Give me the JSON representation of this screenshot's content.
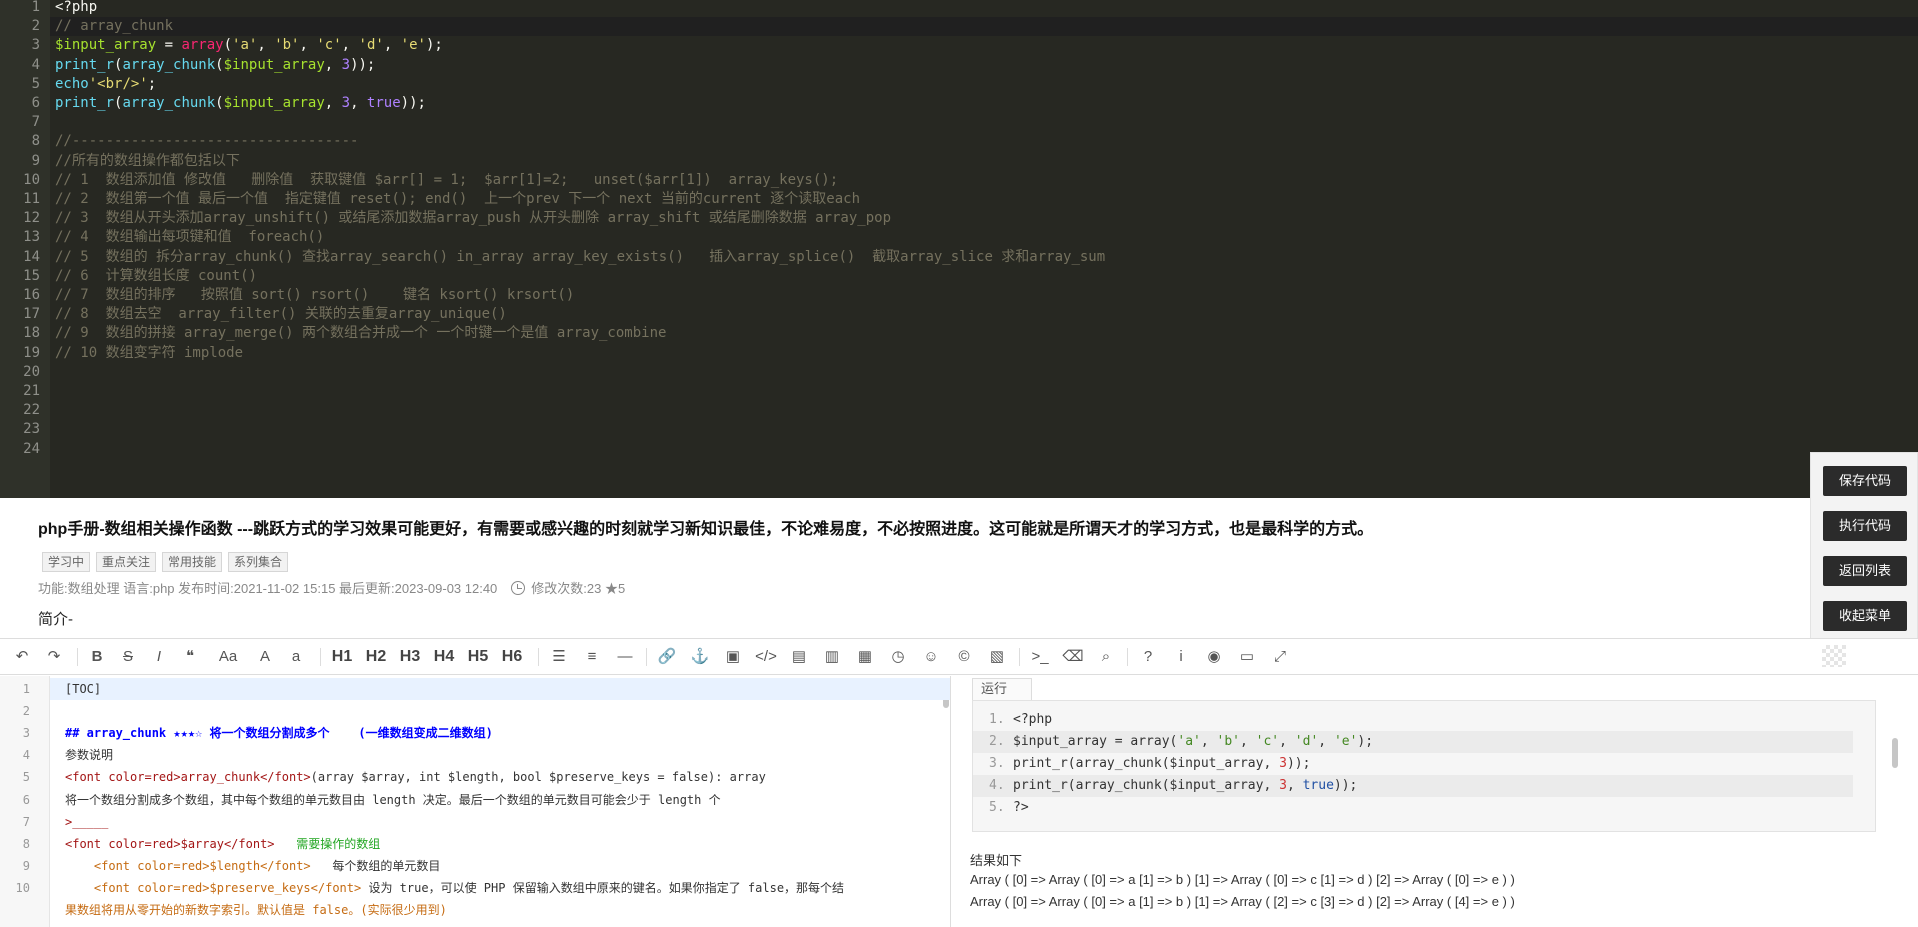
{
  "top_editor": {
    "line_numbers": [
      "1",
      "2",
      "3",
      "4",
      "5",
      "6",
      "7",
      "8",
      "9",
      "10",
      "11",
      "12",
      "13",
      "14",
      "15",
      "16",
      "17",
      "18",
      "19",
      "20",
      "21",
      "22",
      "23",
      "24"
    ],
    "lines": [
      "<?php",
      "// array_chunk",
      "$input_array = array('a', 'b', 'c', 'd', 'e');",
      "print_r(array_chunk($input_array, 3));",
      "echo'<br/>';",
      "print_r(array_chunk($input_array, 3, true));",
      "",
      "//----------------------------------",
      "//所有的数组操作都包括以下",
      "// 1  数组添加值 修改值   删除值  获取键值 $arr[] = 1;  $arr[1]=2;   unset($arr[1])  array_keys();",
      "// 2  数组第一个值 最后一个值  指定键值 reset(); end()  上一个prev 下一个 next 当前的current 逐个读取each",
      "// 3  数组从开头添加array_unshift() 或结尾添加数据array_push 从开头删除 array_shift 或结尾删除数据 array_pop",
      "// 4  数组输出每项键和值  foreach()",
      "// 5  数组的 拆分array_chunk() 查找array_search() in_array array_key_exists()   插入array_splice()  截取array_slice 求和array_sum",
      "// 6  计算数组长度 count()",
      "// 7  数组的排序   按照值 sort() rsort()    键名 ksort() krsort()",
      "// 8  数组去空  array_filter() 关联的去重复array_unique()",
      "// 9  数组的拼接 array_merge() 两个数组合并成一个 一个时键一个是值 array_combine",
      "// 10 数组变字符 implode",
      "",
      "",
      "",
      "",
      ""
    ]
  },
  "side_buttons": {
    "save": "保存代码",
    "run": "执行代码",
    "back": "返回列表",
    "collapse": "收起菜单"
  },
  "article": {
    "title": "php手册-数组相关操作函数 ---跳跃方式的学习效果可能更好，有需要或感兴趣的时刻就学习新知识最佳，不论难易度，不必按照进度。这可能就是所谓天才的学习方式，也是最科学的方式。",
    "tags": [
      "学习中",
      "重点关注",
      "常用技能",
      "系列集合"
    ],
    "meta_left": "功能:数组处理 语言:php 发布时间:2021-11-02 15:15 最后更新:2023-09-03 12:40",
    "meta_right": "修改次数:23 ★5",
    "intro": "简介-"
  },
  "toolbar": {
    "items": [
      {
        "name": "undo-icon",
        "glyph": "↶"
      },
      {
        "name": "redo-icon",
        "glyph": "↷"
      },
      {
        "name": "bold-button",
        "glyph": "B"
      },
      {
        "name": "strikethrough-button",
        "glyph": "S"
      },
      {
        "name": "italic-button",
        "glyph": "I"
      },
      {
        "name": "quote-icon",
        "glyph": "❝"
      },
      {
        "name": "uppercase-button",
        "glyph": "Aa"
      },
      {
        "name": "uppercase-a-button",
        "glyph": "A"
      },
      {
        "name": "lowercase-a-button",
        "glyph": "a"
      },
      {
        "name": "h1-button",
        "glyph": "H1"
      },
      {
        "name": "h2-button",
        "glyph": "H2"
      },
      {
        "name": "h3-button",
        "glyph": "H3"
      },
      {
        "name": "h4-button",
        "glyph": "H4"
      },
      {
        "name": "h5-button",
        "glyph": "H5"
      },
      {
        "name": "h6-button",
        "glyph": "H6"
      },
      {
        "name": "unordered-list-icon",
        "glyph": "☰"
      },
      {
        "name": "ordered-list-icon",
        "glyph": "≡"
      },
      {
        "name": "horizontal-rule-icon",
        "glyph": "—"
      },
      {
        "name": "link-icon",
        "glyph": "🔗"
      },
      {
        "name": "anchor-icon",
        "glyph": "⚓"
      },
      {
        "name": "image-icon",
        "glyph": "▣"
      },
      {
        "name": "code-icon",
        "glyph": "</>"
      },
      {
        "name": "code-file-icon",
        "glyph": "▤"
      },
      {
        "name": "code-block-icon",
        "glyph": "▥"
      },
      {
        "name": "table-icon",
        "glyph": "▦"
      },
      {
        "name": "datetime-icon",
        "glyph": "◷"
      },
      {
        "name": "emoji-icon",
        "glyph": "☺"
      },
      {
        "name": "copyright-icon",
        "glyph": "©"
      },
      {
        "name": "pagebreak-icon",
        "glyph": "▧"
      },
      {
        "name": "terminal-icon",
        "glyph": ">_"
      },
      {
        "name": "eraser-icon",
        "glyph": "⌫"
      },
      {
        "name": "search-icon",
        "glyph": "⌕"
      },
      {
        "name": "help-icon",
        "glyph": "?"
      },
      {
        "name": "info-icon",
        "glyph": "i"
      },
      {
        "name": "preview-toggle-icon",
        "glyph": "◉"
      },
      {
        "name": "desktop-icon",
        "glyph": "▭"
      },
      {
        "name": "fullscreen-icon",
        "glyph": "⤢"
      }
    ]
  },
  "md_editor": {
    "line_numbers": [
      "1",
      "2",
      "3",
      "4",
      "5",
      "6",
      "7",
      "8",
      "9",
      "10"
    ],
    "lines": [
      "[TOC]",
      "",
      "## array_chunk ★★★☆ 将一个数组分割成多个    (一维数组变成二维数组)",
      "参数说明",
      "<font color=red>array_chunk</font>(array $array, int $length, bool $preserve_keys = false): array",
      "将一个数组分割成多个数组，其中每个数组的单元数目由 length 决定。最后一个数组的单元数目可能会少于 length 个",
      ">_____",
      "<font color=red>$array</font>   需要操作的数组",
      "    <font color=red>$length</font>   每个数组的单元数目",
      "    <font color=red>$preserve_keys</font> 设为 true，可以使 PHP 保留输入数组中原来的键名。如果你指定了 false，那每个结",
      "果数组将用从零开始的新数字索引。默认值是 false。(实际很少用到)"
    ]
  },
  "preview": {
    "run_tab": "运行",
    "code_lines": [
      "<?php",
      "$input_array = array('a', 'b', 'c', 'd', 'e');",
      "print_r(array_chunk($input_array, 3));",
      "print_r(array_chunk($input_array, 3, true));",
      "?>"
    ],
    "code_numbers": [
      "1.",
      "2.",
      "3.",
      "4.",
      "5."
    ],
    "result_label": "结果如下",
    "results": [
      "Array ( [0] => Array ( [0] => a [1] => b ) [1] => Array ( [0] => c [1] => d ) [2] => Array ( [0] => e ) )",
      "Array ( [0] => Array ( [0] => a [1] => b ) [1] => Array ( [2] => c [3] => d ) [2] => Array ( [4] => e ) )"
    ]
  },
  "colors": {
    "editor_bg": "#272822",
    "comment": "#75715e",
    "keyword": "#f92672",
    "function": "#66d9ef",
    "string": "#e6db74",
    "number": "#ae81ff",
    "variable": "#a6e22e",
    "side_button_bg": "#2b2b2b"
  }
}
